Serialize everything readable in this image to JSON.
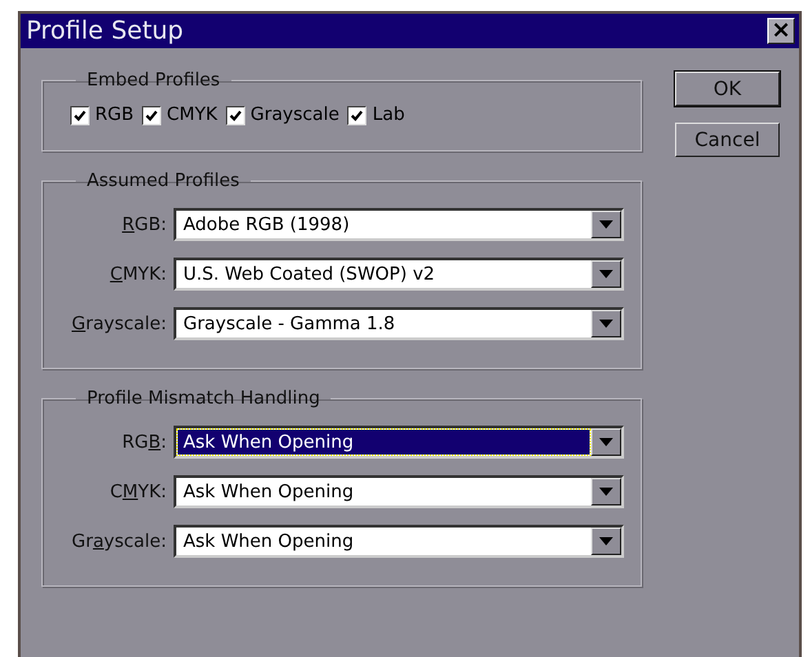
{
  "window": {
    "title": "Profile Setup",
    "close": "×"
  },
  "embed_profiles": {
    "title": "Embed Profiles",
    "checkboxes": [
      {
        "label": "RGB",
        "checked": true
      },
      {
        "label": "CMYK",
        "checked": true
      },
      {
        "label": "Grayscale",
        "checked": true
      },
      {
        "label": "Lab",
        "checked": true
      }
    ]
  },
  "assumed_profiles": {
    "title": "Assumed Profiles",
    "rows": [
      {
        "label": {
          "key": "R",
          "after": "GB:"
        },
        "value": "Adobe RGB (1998)",
        "focused": false
      },
      {
        "label": {
          "key": "C",
          "after": "MYK:"
        },
        "value": "U.S. Web Coated (SWOP) v2",
        "focused": false
      },
      {
        "label": {
          "key": "G",
          "after": "rayscale:"
        },
        "value": "Grayscale - Gamma 1.8",
        "focused": false
      }
    ]
  },
  "profile_mismatch_handling": {
    "title": "Profile Mismatch Handling",
    "rows": [
      {
        "label": {
          "before": "RG",
          "key": "B",
          "after": ":"
        },
        "value": "Ask When Opening",
        "focused": true
      },
      {
        "label": {
          "before": "C",
          "key": "M",
          "after": "YK:"
        },
        "value": "Ask When Opening",
        "focused": false
      },
      {
        "label": {
          "before": "Gr",
          "key": "a",
          "after": "yscale:"
        },
        "value": "Ask When Opening",
        "focused": false
      }
    ]
  },
  "buttons": [
    "OK",
    "Cancel"
  ]
}
